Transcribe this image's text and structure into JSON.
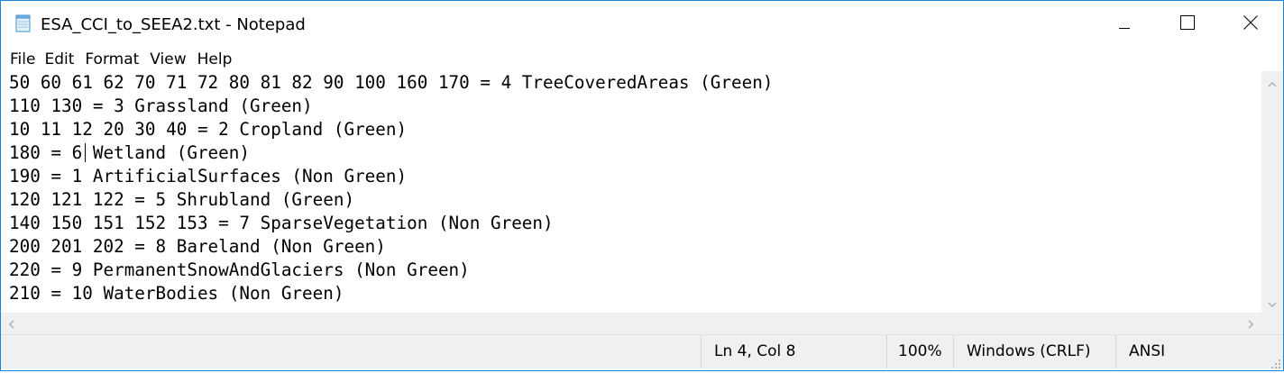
{
  "window": {
    "title": "ESA_CCI_to_SEEA2.txt - Notepad",
    "accent_color": "#1883d7",
    "icons": {
      "app": "notepad-icon",
      "minimize": "minimize-icon",
      "maximize": "maximize-icon",
      "close": "close-icon"
    }
  },
  "menu": {
    "items": [
      "File",
      "Edit",
      "Format",
      "View",
      "Help"
    ]
  },
  "editor": {
    "lines": [
      "50 60 61 62 70 71 72 80 81 82 90 100 160 170 = 4 TreeCoveredAreas (Green)",
      "110 130 = 3 Grassland (Green)",
      "10 11 12 20 30 40 = 2 Cropland (Green)",
      "180 = 6 Wetland (Green)",
      "190 = 1 ArtificialSurfaces (Non Green)",
      "120 121 122 = 5 Shrubland (Green)",
      "140 150 151 152 153 = 7 SparseVegetation (Non Green)",
      "200 201 202 = 8 Bareland (Non Green)",
      "220 = 9 PermanentSnowAndGlaciers (Non Green)",
      "210 = 10 WaterBodies (Non Green)"
    ]
  },
  "statusbar": {
    "position": "Ln 4, Col 8",
    "zoom": "100%",
    "line_ending": "Windows (CRLF)",
    "encoding": "ANSI"
  }
}
